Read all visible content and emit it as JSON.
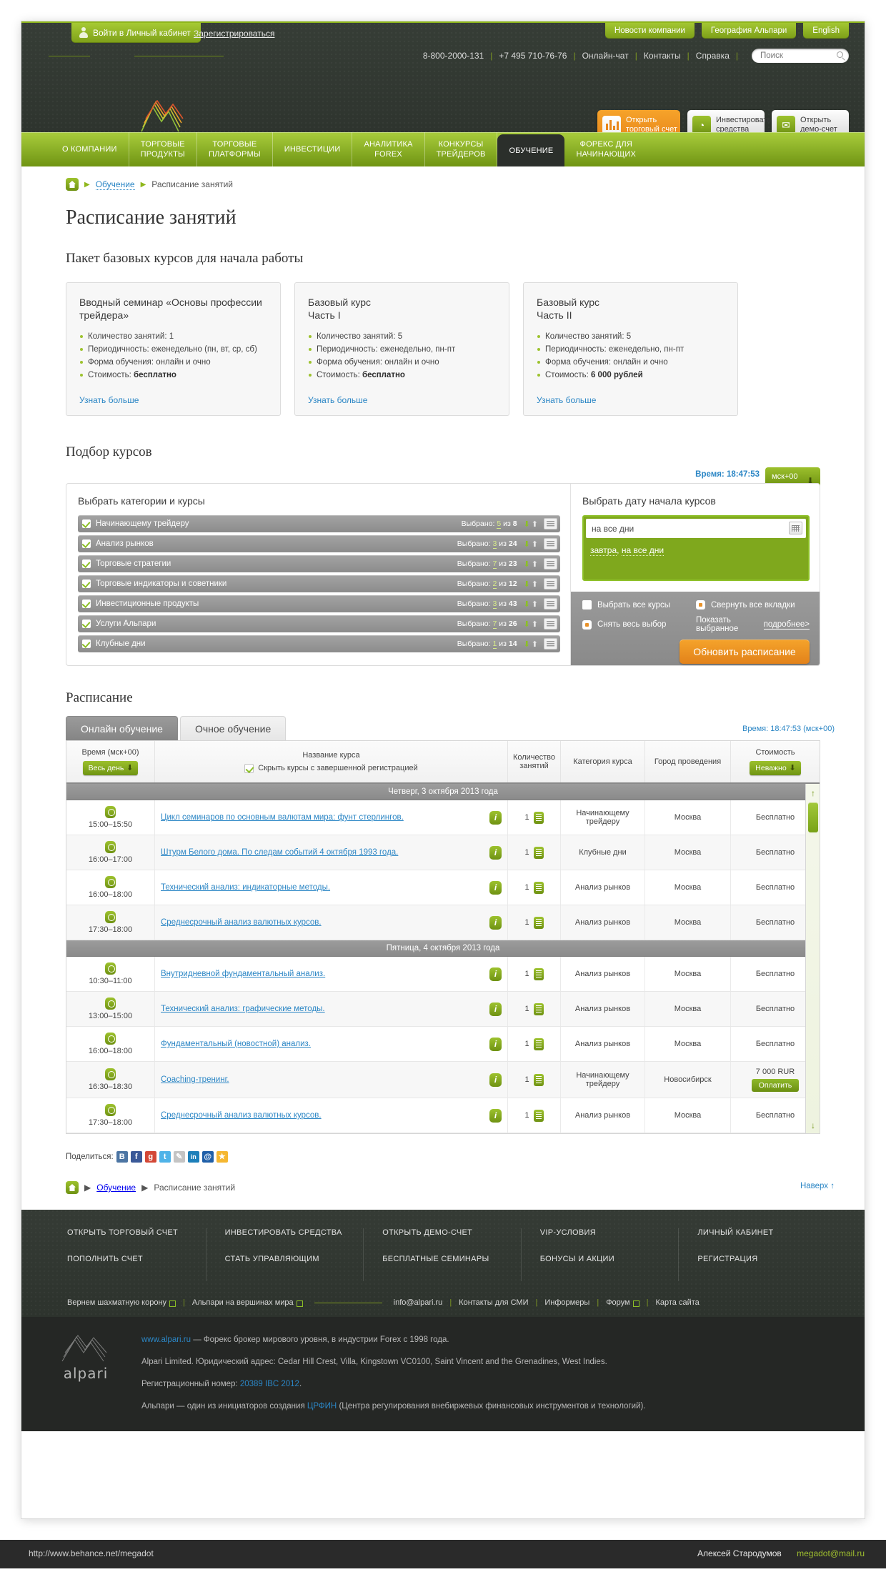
{
  "topbar": {
    "login_label": "Войти в Личный кабинет",
    "register_label": "Зарегистрироваться",
    "buttons": [
      {
        "label": "Новости компании"
      },
      {
        "label": "География Альпари"
      },
      {
        "label": "English"
      }
    ]
  },
  "contacts": {
    "phone1": "8-800-2000-131",
    "phone2": "+7 495 710-76-76",
    "chat": "Онлайн-чат",
    "contacts": "Контакты",
    "help": "Справка",
    "search_placeholder": "Поиск",
    "search_value": ""
  },
  "brand": {
    "name": "alpari"
  },
  "action_buttons": [
    {
      "line1": "Открыть",
      "line2": "торговый счет",
      "style": "orange",
      "icon": "chart-bars-icon"
    },
    {
      "line1": "Инвестировать",
      "line2": "средства",
      "style": "white",
      "icon": "piggy-icon"
    },
    {
      "line1": "Открыть",
      "line2": "демо-счет",
      "style": "white",
      "icon": "envelope-icon"
    }
  ],
  "nav": [
    {
      "line1": "О КОМПАНИИ",
      "line2": "",
      "active": false
    },
    {
      "line1": "ТОРГОВЫЕ",
      "line2": "ПРОДУКТЫ",
      "active": false
    },
    {
      "line1": "ТОРГОВЫЕ",
      "line2": "ПЛАТФОРМЫ",
      "active": false
    },
    {
      "line1": "ИНВЕСТИЦИИ",
      "line2": "",
      "active": false
    },
    {
      "line1": "АНАЛИТИКА",
      "line2": "FOREX",
      "active": false
    },
    {
      "line1": "КОНКУРСЫ",
      "line2": "ТРЕЙДЕРОВ",
      "active": false
    },
    {
      "line1": "ОБУЧЕНИЕ",
      "line2": "",
      "active": true
    },
    {
      "line1": "ФОРЕКС ДЛЯ",
      "line2": "НАЧИНАЮЩИХ",
      "active": false
    }
  ],
  "breadcrumb": {
    "home": "home-icon",
    "link": "Обучение",
    "current": "Расписание занятий"
  },
  "page": {
    "title": "Расписание занятий",
    "subtitle": "Пакет базовых курсов для начала работы",
    "pick_title": "Подбор курсов",
    "schedule_title": "Расписание"
  },
  "cards": [
    {
      "title": "Вводный семинар «Основы профессии трейдера»",
      "items": [
        {
          "text": "Количество занятий: 1",
          "bold": ""
        },
        {
          "text": "Периодичность: еженедельно (пн, вт, ср, сб)",
          "bold": ""
        },
        {
          "text": "Форма обучения: онлайн и очно",
          "bold": ""
        },
        {
          "text": "Стоимость: ",
          "bold": "бесплатно"
        }
      ],
      "more": "Узнать больше"
    },
    {
      "title": "Базовый курс\nЧасть I",
      "title_l1": "Базовый курс",
      "title_l2": "Часть I",
      "items": [
        {
          "text": "Количество занятий: 5",
          "bold": ""
        },
        {
          "text": "Периодичность: еженедельно, пн-пт",
          "bold": ""
        },
        {
          "text": "Форма обучения: онлайн и очно",
          "bold": ""
        },
        {
          "text": "Стоимость: ",
          "bold": "бесплатно"
        }
      ],
      "more": "Узнать больше"
    },
    {
      "title": "Базовый курс\nЧасть II",
      "title_l1": "Базовый курс",
      "title_l2": "Часть II",
      "items": [
        {
          "text": "Количество занятий: 5",
          "bold": ""
        },
        {
          "text": "Периодичность: еженедельно, пн-пт",
          "bold": ""
        },
        {
          "text": "Форма обучения: онлайн и очно",
          "bold": ""
        },
        {
          "text": "Стоимость: ",
          "bold": "6 000 рублей"
        }
      ],
      "more": "Узнать больше"
    }
  ],
  "timestrip": {
    "time_label": "Время: 18:47:53",
    "tz_label": "мск+00"
  },
  "selector": {
    "left_title": "Выбрать категории и курсы",
    "right_title": "Выбрать дату начала курсов",
    "categories": [
      {
        "name": "Начинающему трейдеру",
        "prefix": "Выбрано:",
        "selected": "5",
        "middle": "из",
        "total": "8"
      },
      {
        "name": "Анализ рынков",
        "prefix": "Выбрано:",
        "selected": "3",
        "middle": "из",
        "total": "24"
      },
      {
        "name": "Торговые стратегии",
        "prefix": "Выбрано:",
        "selected": "7",
        "middle": "из",
        "total": "23"
      },
      {
        "name": "Торговые индикаторы и советники",
        "prefix": "Выбрано:",
        "selected": "2",
        "middle": "из",
        "total": "12"
      },
      {
        "name": "Инвестиционные продукты",
        "prefix": "Выбрано:",
        "selected": "3",
        "middle": "из",
        "total": "43"
      },
      {
        "name": "Услуги Альпари",
        "prefix": "Выбрано:",
        "selected": "7",
        "middle": "из",
        "total": "26"
      },
      {
        "name": "Клубные дни",
        "prefix": "Выбрано:",
        "selected": "1",
        "middle": "из",
        "total": "14"
      }
    ],
    "date_value": "на все дни",
    "date_hint_1": "завтра",
    "date_hint_2": "на все дни",
    "opt_select_all": "Выбрать все курсы",
    "opt_collapse_all": "Свернуть все вкладки",
    "opt_clear_all": "Снять весь выбор",
    "opt_show_selected": "Показать выбранное",
    "opt_show_more": "подробнее>",
    "update_button": "Обновить расписание"
  },
  "schedule": {
    "tabs": [
      {
        "label": "Онлайн обучение",
        "active": true
      },
      {
        "label": "Очное обучение",
        "active": false
      }
    ],
    "tab_time": "Время: 18:47:53 (мск+00)",
    "columns": {
      "time": "Время (мск+00)",
      "time_filter": "Весь день",
      "course": "Название курса",
      "hide_completed": "Скрыть курсы с завершенной регистрацией",
      "count_l1": "Количество",
      "count_l2": "занятий",
      "category": "Категория курса",
      "city": "Город проведения",
      "price": "Стоимость",
      "price_filter": "Неважно"
    },
    "days": [
      {
        "day_label": "Четверг, 3 октября 2013 года",
        "rows": [
          {
            "time": "15:00–15:50",
            "course": "Цикл семинаров по основным валютам мира: фунт стерлингов.",
            "count": "1",
            "category": "Начинающему трейдеру",
            "city": "Москва",
            "price": "Бесплатно",
            "pay": ""
          },
          {
            "time": "16:00–17:00",
            "course": "Штурм Белого дома. По следам событий 4 октября 1993 года.",
            "count": "1",
            "category": "Клубные дни",
            "city": "Москва",
            "price": "Бесплатно",
            "pay": ""
          },
          {
            "time": "16:00–18:00",
            "course": "Технический анализ: индикаторные методы.",
            "count": "1",
            "category": "Анализ рынков",
            "city": "Москва",
            "price": "Бесплатно",
            "pay": ""
          },
          {
            "time": "17:30–18:00",
            "course": "Среднесрочный анализ валютных курсов.",
            "count": "1",
            "category": "Анализ рынков",
            "city": "Москва",
            "price": "Бесплатно",
            "pay": ""
          }
        ]
      },
      {
        "day_label": "Пятница, 4 октября 2013 года",
        "rows": [
          {
            "time": "10:30–11:00",
            "course": "Внутридневной фундаментальный анализ.",
            "count": "1",
            "category": "Анализ рынков",
            "city": "Москва",
            "price": "Бесплатно",
            "pay": ""
          },
          {
            "time": "13:00–15:00",
            "course": "Технический анализ: графические методы.",
            "count": "1",
            "category": "Анализ рынков",
            "city": "Москва",
            "price": "Бесплатно",
            "pay": ""
          },
          {
            "time": "16:00–18:00",
            "course": "Фундаментальный (новостной) анализ.",
            "count": "1",
            "category": "Анализ рынков",
            "city": "Москва",
            "price": "Бесплатно",
            "pay": ""
          },
          {
            "time": "16:30–18:30",
            "course": "Coaching-тренинг.",
            "count": "1",
            "category": "Начинающему трейдеру",
            "city": "Новосибирск",
            "price": "7 000 RUR",
            "pay": "Оплатить"
          },
          {
            "time": "17:30–18:00",
            "course": "Среднесрочный анализ валютных курсов.",
            "count": "1",
            "category": "Анализ рынков",
            "city": "Москва",
            "price": "Бесплатно",
            "pay": ""
          }
        ]
      }
    ]
  },
  "share": {
    "label": "Поделиться:",
    "icons": [
      {
        "name": "vk-icon",
        "glyph": "В",
        "color": "#4c75a3"
      },
      {
        "name": "facebook-icon",
        "glyph": "f",
        "color": "#3b5998"
      },
      {
        "name": "google-plus-icon",
        "glyph": "g",
        "color": "#d34836"
      },
      {
        "name": "twitter-icon",
        "glyph": "t",
        "color": "#4fb3e8"
      },
      {
        "name": "livejournal-icon",
        "glyph": "✎",
        "color": "#c4c4c4"
      },
      {
        "name": "linkedin-icon",
        "glyph": "in",
        "color": "#1c7fba"
      },
      {
        "name": "mailru-icon",
        "glyph": "@",
        "color": "#1f5fa8"
      },
      {
        "name": "favorites-icon",
        "glyph": "★",
        "color": "#f5b731"
      }
    ]
  },
  "footer_bottom_nav": {
    "link": "Обучение",
    "current": "Расписание занятий",
    "up_label": "Наверх ↑"
  },
  "footer": {
    "columns": [
      [
        "ОТКРЫТЬ ТОРГОВЫЙ СЧЕТ",
        "ПОПОЛНИТЬ СЧЕТ"
      ],
      [
        "ИНВЕСТИРОВАТЬ СРЕДСТВА",
        "СТАТЬ УПРАВЛЯЮЩИМ"
      ],
      [
        "ОТКРЫТЬ ДЕМО-СЧЕТ",
        "БЕСПЛАТНЫЕ СЕМИНАРЫ"
      ],
      [
        "VIP-УСЛОВИЯ",
        "БОНУСЫ И АКЦИИ"
      ],
      [
        "ЛИЧНЫЙ КАБИНЕТ",
        "РЕГИСТРАЦИЯ"
      ]
    ],
    "bar": {
      "chess": "Вернем шахматную корону",
      "peaks": "Альпари на вершинах мира",
      "email": "info@alpari.ru",
      "smi": "Контакты для СМИ",
      "informers": "Информеры",
      "forum": "Форум",
      "sitemap": "Карта сайта"
    }
  },
  "legal": {
    "brand": "alpari",
    "line1_link": "www.alpari.ru",
    "line1_rest": " — Форекс брокер мирового уровня, в индустрии Forex с 1998 года.",
    "line2": "Alpari Limited. Юридический адрес: Cedar Hill Crest, Villa, Kingstown VC0100, Saint Vincent and the Grenadines, West Indies.",
    "line3_label": "Регистрационный номер: ",
    "line3_link": "20389 IBC 2012",
    "line3_end": ".",
    "line4_a": "Альпари — один из инициаторов создания ",
    "line4_link": "ЦРФИН",
    "line4_b": " (Центра регулирования внебиржевых финансовых инструментов и технологий)."
  },
  "statusbar": {
    "url": "http://www.behance.net/megadot",
    "author": "Алексей Стародумов",
    "email": "megadot@mail.ru"
  }
}
